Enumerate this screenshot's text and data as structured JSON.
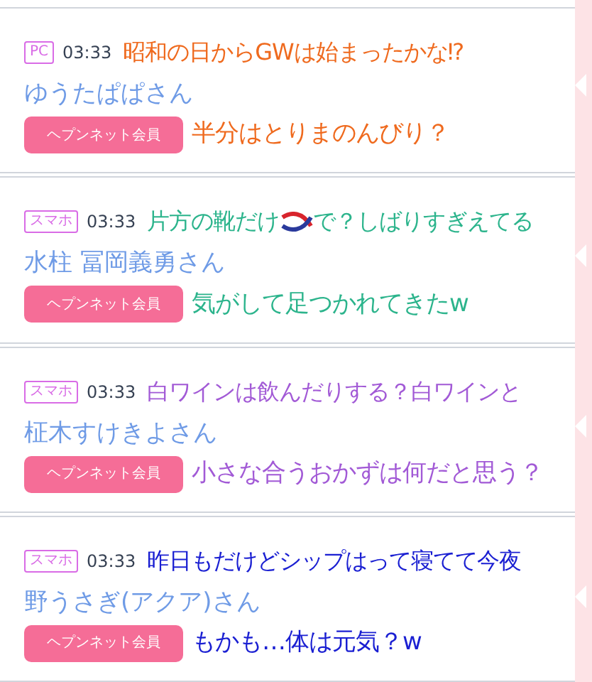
{
  "posts": [
    {
      "device": "PC",
      "time": "03:33",
      "name": "ゆうたぱぱさん",
      "member_badge": "ヘプンネット会員",
      "color": "#ef6a1e",
      "overlay_top": [
        {
          "kind": "text",
          "text": "昭和の日からGWは始まったかな⁉"
        }
      ],
      "overlay_bottom": "半分はとりまのんびり？"
    },
    {
      "device": "スマホ",
      "time": "03:33",
      "name": "水柱 冨岡義勇さん",
      "member_badge": "ヘプンネット会員",
      "color": "#2cb48c",
      "overlay_top": [
        {
          "kind": "text",
          "text": "片方の靴だけ"
        },
        {
          "kind": "knot"
        },
        {
          "kind": "text",
          "text": "で？しばりすぎえてる"
        }
      ],
      "overlay_bottom": "気がして足つかれてきたw"
    },
    {
      "device": "スマホ",
      "time": "03:33",
      "name": "柾木すけきよさん",
      "member_badge": "ヘプンネット会員",
      "color": "#a25ad6",
      "overlay_top": [
        {
          "kind": "text",
          "text": "白ワインは飲んだりする？白ワインと"
        }
      ],
      "overlay_bottom": "小さな合うおかずは何だと思う？"
    },
    {
      "device": "スマホ",
      "time": "03:33",
      "name": "野うさぎ(アクア)さん",
      "member_badge": "ヘプンネット会員",
      "color": "#1a1fd2",
      "overlay_top": [
        {
          "kind": "text",
          "text": "昨日もだけどシップはって寝てて今夜"
        }
      ],
      "overlay_bottom": "もかも…体は元気？w"
    }
  ]
}
